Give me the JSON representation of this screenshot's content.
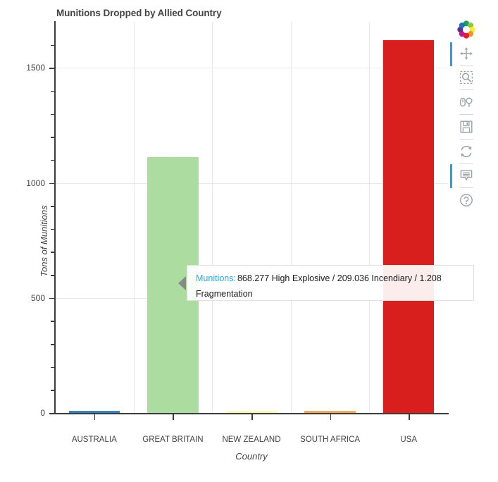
{
  "chart": {
    "title": "Munitions Dropped by Allied Country",
    "xlabel": "Country",
    "ylabel": "Tons of Munitions"
  },
  "chart_data": {
    "type": "bar",
    "title": "Munitions Dropped by Allied Country",
    "xlabel": "Country",
    "ylabel": "Tons of Munitions",
    "categories": [
      "AUSTRALIA",
      "GREAT BRITAIN",
      "NEW ZEALAND",
      "SOUTH AFRICA",
      "USA"
    ],
    "values": [
      9,
      1113,
      7,
      6,
      1620
    ],
    "colors": [
      "#3182bd",
      "#addca1",
      "#fcfbb6",
      "#f8a65c",
      "#d91e1e"
    ],
    "ylim": [
      0,
      1700
    ],
    "yticks": [
      0,
      500,
      1000,
      1500
    ],
    "ytick_labels": [
      "0",
      "500",
      "1000",
      "1500"
    ],
    "y_minor_ticks": [
      100,
      200,
      300,
      400,
      600,
      700,
      800,
      900,
      1100,
      1200,
      1300,
      1400,
      1600
    ],
    "grid": "horizontal-and-vertical",
    "legend": "none"
  },
  "tooltip": {
    "label": "Munitions:",
    "value": "868.277 High Explosive / 209.036 Incendiary / 1.208 Fragmentation",
    "target_category": "GREAT BRITAIN"
  },
  "toolbar": {
    "items": [
      {
        "name": "bokeh-logo-icon",
        "label": "Bokeh",
        "active": false
      },
      {
        "name": "pan-tool-button",
        "label": "Pan",
        "active": true
      },
      {
        "name": "box-zoom-tool-button",
        "label": "Box Zoom",
        "active": false
      },
      {
        "name": "wheel-zoom-tool-button",
        "label": "Wheel Zoom",
        "active": false
      },
      {
        "name": "save-tool-button",
        "label": "Save",
        "active": false
      },
      {
        "name": "reset-tool-button",
        "label": "Reset",
        "active": false
      },
      {
        "name": "hover-tool-button",
        "label": "Hover",
        "active": true
      },
      {
        "name": "help-tool-button",
        "label": "Help",
        "active": false
      }
    ]
  }
}
